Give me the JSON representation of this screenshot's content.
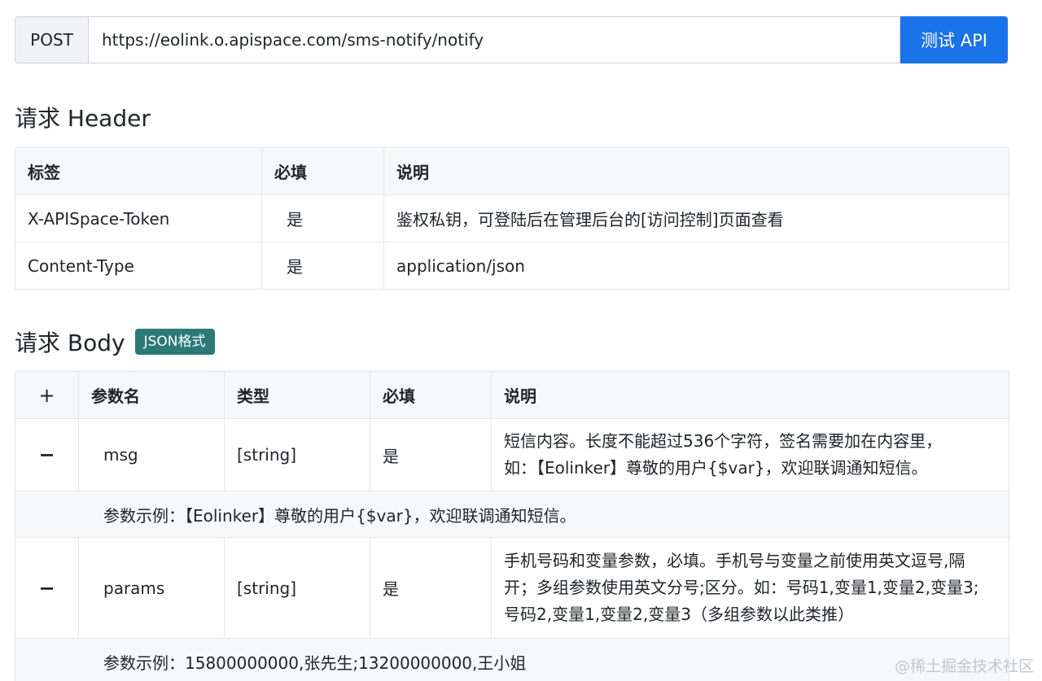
{
  "request": {
    "method": "POST",
    "url": "https://eolink.o.apispace.com/sms-notify/notify",
    "test_button": "测试 API"
  },
  "header_section": {
    "title": "请求 Header",
    "columns": [
      "标签",
      "必填",
      "说明"
    ],
    "rows": [
      {
        "tag": "X-APISpace-Token",
        "required": "是",
        "desc": "鉴权私钥，可登陆后在管理后台的[访问控制]页面查看"
      },
      {
        "tag": "Content-Type",
        "required": "是",
        "desc": "application/json"
      }
    ]
  },
  "body_section": {
    "title": "请求 Body",
    "badge": "JSON格式",
    "expand_all": "+",
    "columns": [
      "参数名",
      "类型",
      "必填",
      "说明"
    ],
    "params": [
      {
        "toggle": "−",
        "name": "msg",
        "type": "[string]",
        "required": "是",
        "desc_lines": [
          "短信内容。长度不能超过536个字符，签名需要加在内容里，",
          "如：【Eolinker】尊敬的用户{$var}，欢迎联调通知短信。"
        ],
        "example": "参数示例：【Eolinker】尊敬的用户{$var}，欢迎联调通知短信。"
      },
      {
        "toggle": "−",
        "name": "params",
        "type": "[string]",
        "required": "是",
        "desc_lines": [
          "手机号码和变量参数，必填。手机号与变量之前使用英文逗号,隔",
          "开；多组参数使用英文分号;区分。如：号码1,变量1,变量2,变量3;",
          "号码2,变量1,变量2,变量3（多组参数以此类推）"
        ],
        "example": "参数示例：15800000000,张先生;13200000000,王小姐"
      }
    ]
  },
  "watermark": "@稀土掘金技术社区"
}
